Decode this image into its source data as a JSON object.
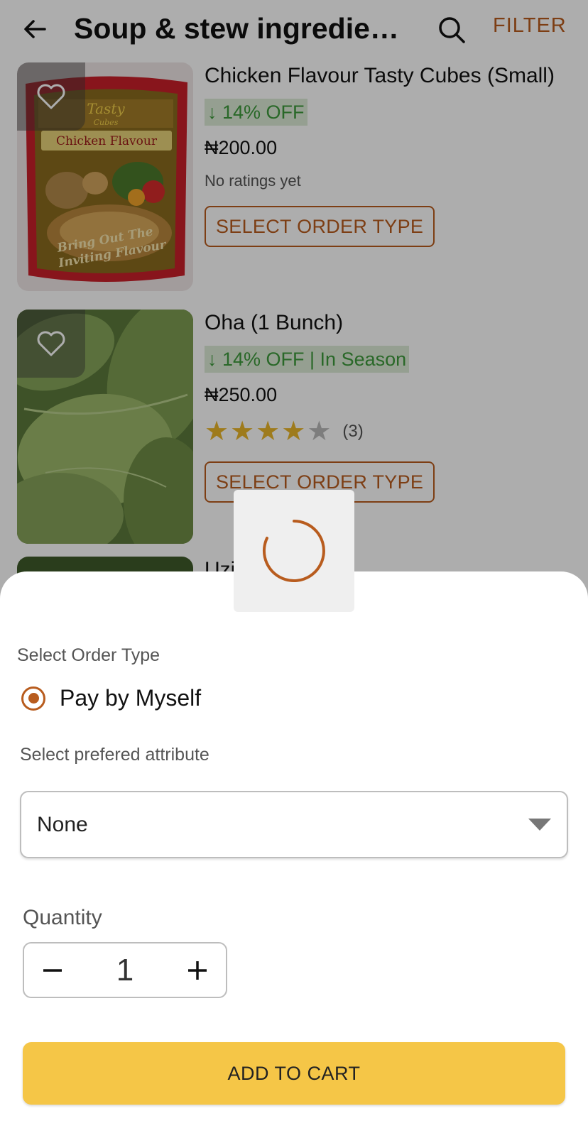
{
  "appbar": {
    "title": "Soup & stew ingredien…",
    "filter_label": "FILTER",
    "back_icon": "arrow-left-icon",
    "search_icon": "search-icon"
  },
  "products": [
    {
      "name": "Chicken Flavour Tasty Cubes (Small)",
      "discount": "↓ 14% OFF",
      "price": "₦200.00",
      "rating_text": "No ratings yet",
      "order_button": "SELECT ORDER TYPE",
      "image_label_brand": "Tasty Cubes",
      "image_label_flavour": "Chicken Flavour",
      "image_label_tagline": "Bring Out The Inviting Flavour"
    },
    {
      "name": "Oha (1 Bunch)",
      "discount": "↓ 14% OFF | In Season",
      "price": "₦250.00",
      "stars": 4,
      "stars_max": 5,
      "rating_count": "(3)",
      "order_button": "SELECT ORDER TYPE"
    },
    {
      "name": "Uzi"
    }
  ],
  "sheet": {
    "order_type_label": "Select Order Type",
    "order_option": "Pay by Myself",
    "order_option_selected": true,
    "attribute_label": "Select prefered attribute",
    "attribute_value": "None",
    "quantity_label": "Quantity",
    "quantity_value": "1",
    "decrement_symbol": "−",
    "increment_symbol": "+",
    "add_to_cart": "ADD TO CART"
  },
  "colors": {
    "accent": "#b85c1e",
    "cart_button": "#f5c647",
    "discount_text": "#3d9a3b",
    "star_on": "#e9b52a"
  }
}
